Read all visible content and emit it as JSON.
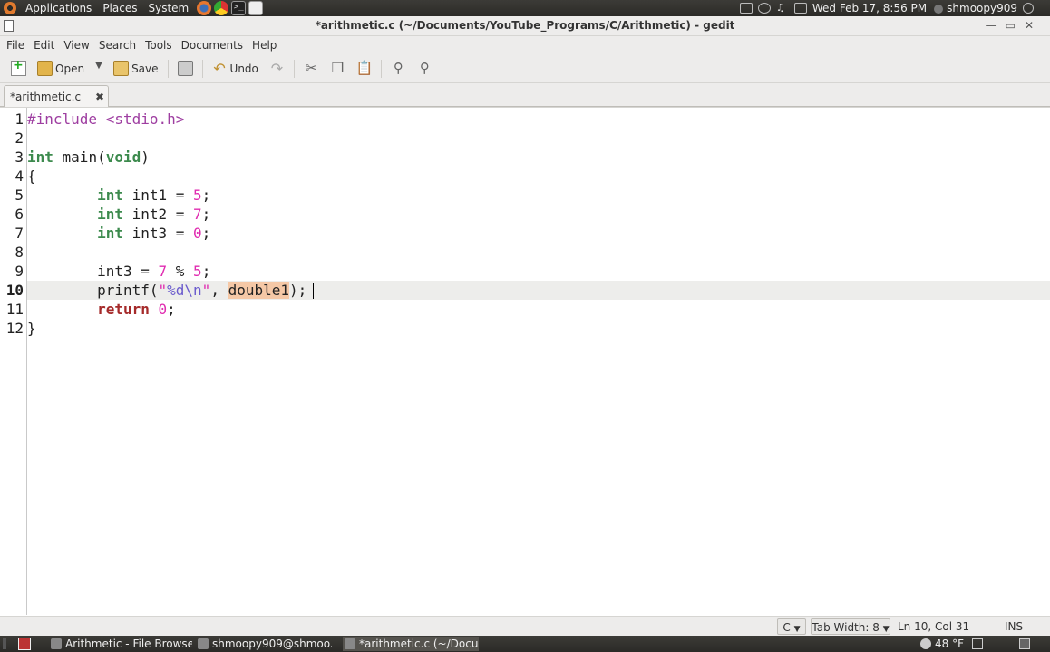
{
  "top_panel": {
    "menus": [
      "Applications",
      "Places",
      "System"
    ],
    "clock": "Wed Feb 17,  8:56 PM",
    "user": "shmoopy909"
  },
  "window": {
    "title": "*arithmetic.c (~/Documents/YouTube_Programs/C/Arithmetic) - gedit"
  },
  "menubar": [
    "File",
    "Edit",
    "View",
    "Search",
    "Tools",
    "Documents",
    "Help"
  ],
  "toolbar": {
    "open_label": "Open",
    "save_label": "Save",
    "undo_label": "Undo"
  },
  "tab": {
    "label": "*arithmetic.c",
    "close": "✖"
  },
  "editor": {
    "line_numbers": [
      "1",
      "2",
      "3",
      "4",
      "5",
      "6",
      "7",
      "8",
      "9",
      "10",
      "11",
      "12"
    ],
    "current_line": 10,
    "lines": [
      "#include <stdio.h>",
      "",
      "int main(void)",
      "{",
      "        int int1 = 5;",
      "        int int2 = 7;",
      "        int int3 = 0;",
      "",
      "        int3 = 7 % 5;",
      "        printf(\"%d\\n\", double1);",
      "        return 0;",
      "}"
    ]
  },
  "statusbar": {
    "language": "C",
    "tab_width": "Tab Width:  8",
    "position": "Ln 10, Col 31",
    "mode": "INS"
  },
  "taskbar": {
    "items": [
      "Arithmetic - File Browser",
      "shmoopy909@shmoo...",
      "*arithmetic.c (~/Docu..."
    ],
    "weather": "48 °F"
  },
  "colors": {
    "keyword": "#3c8a4d",
    "return_keyword": "#a52a2a",
    "number": "#e02bb0",
    "preprocessor": "#9e3ea1",
    "match_highlight": "#f5c8a6",
    "current_line": "#ededeb"
  }
}
